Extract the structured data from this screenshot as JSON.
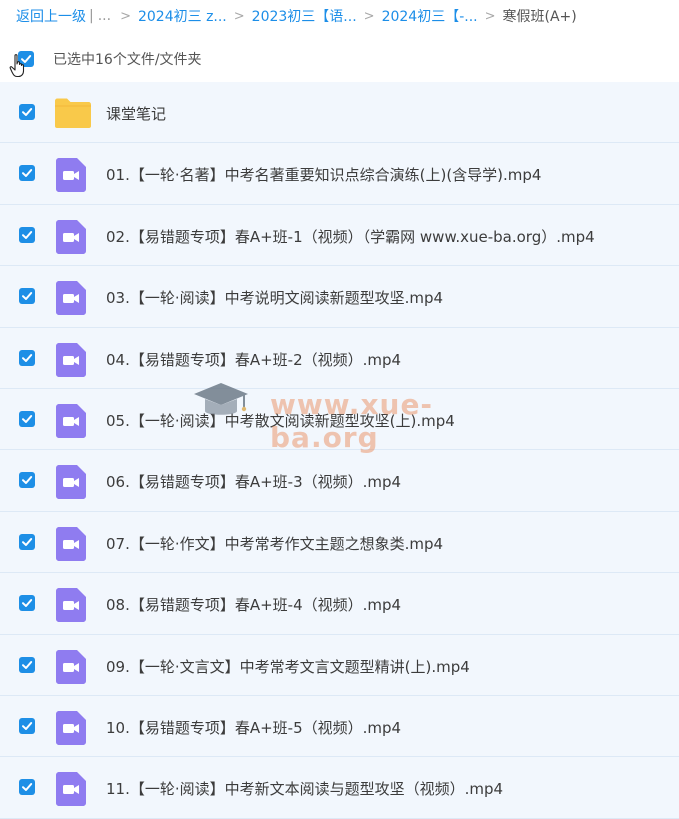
{
  "breadcrumb": {
    "back": "返回上一级",
    "pipe": "|",
    "dots": "...",
    "separator": ">",
    "items": [
      "2024初三 z...",
      "2023初三【语...",
      "2024初三【-..."
    ],
    "current": "寒假班(A+)"
  },
  "selection": {
    "text": "已选中16个文件/文件夹",
    "checked": true
  },
  "files": [
    {
      "type": "folder",
      "name": "课堂笔记",
      "checked": true
    },
    {
      "type": "video",
      "name": "01.【一轮·名著】中考名著重要知识点综合演练(上)(含导学).mp4",
      "checked": true
    },
    {
      "type": "video",
      "name": "02.【易错题专项】春A+班-1（视频）（学霸网 www.xue-ba.org）.mp4",
      "checked": true
    },
    {
      "type": "video",
      "name": "03.【一轮·阅读】中考说明文阅读新题型攻坚.mp4",
      "checked": true
    },
    {
      "type": "video",
      "name": "04.【易错题专项】春A+班-2（视频）.mp4",
      "checked": true
    },
    {
      "type": "video",
      "name": "05.【一轮·阅读】中考散文阅读新题型攻坚(上).mp4",
      "checked": true
    },
    {
      "type": "video",
      "name": "06.【易错题专项】春A+班-3（视频）.mp4",
      "checked": true
    },
    {
      "type": "video",
      "name": "07.【一轮·作文】中考常考作文主题之想象类.mp4",
      "checked": true
    },
    {
      "type": "video",
      "name": "08.【易错题专项】春A+班-4（视频）.mp4",
      "checked": true
    },
    {
      "type": "video",
      "name": "09.【一轮·文言文】中考常考文言文题型精讲(上).mp4",
      "checked": true
    },
    {
      "type": "video",
      "name": "10.【易错题专项】春A+班-5（视频）.mp4",
      "checked": true
    },
    {
      "type": "video",
      "name": "11.【一轮·阅读】中考新文本阅读与题型攻坚（视频）.mp4",
      "checked": true
    }
  ],
  "watermark": {
    "text": "www.xue-ba.org"
  },
  "colors": {
    "link": "#1c8ee8",
    "checkbox": "#1e8fe6",
    "row_bg": "#f2f7fd",
    "folder": "#f9c94a",
    "video_icon": "#8f7cf0"
  },
  "icons": {
    "checkbox": "checkmark-icon",
    "folder": "folder-icon",
    "video": "video-file-icon",
    "cursor": "hand-pointer-icon",
    "watermark": "graduation-cap-icon"
  }
}
